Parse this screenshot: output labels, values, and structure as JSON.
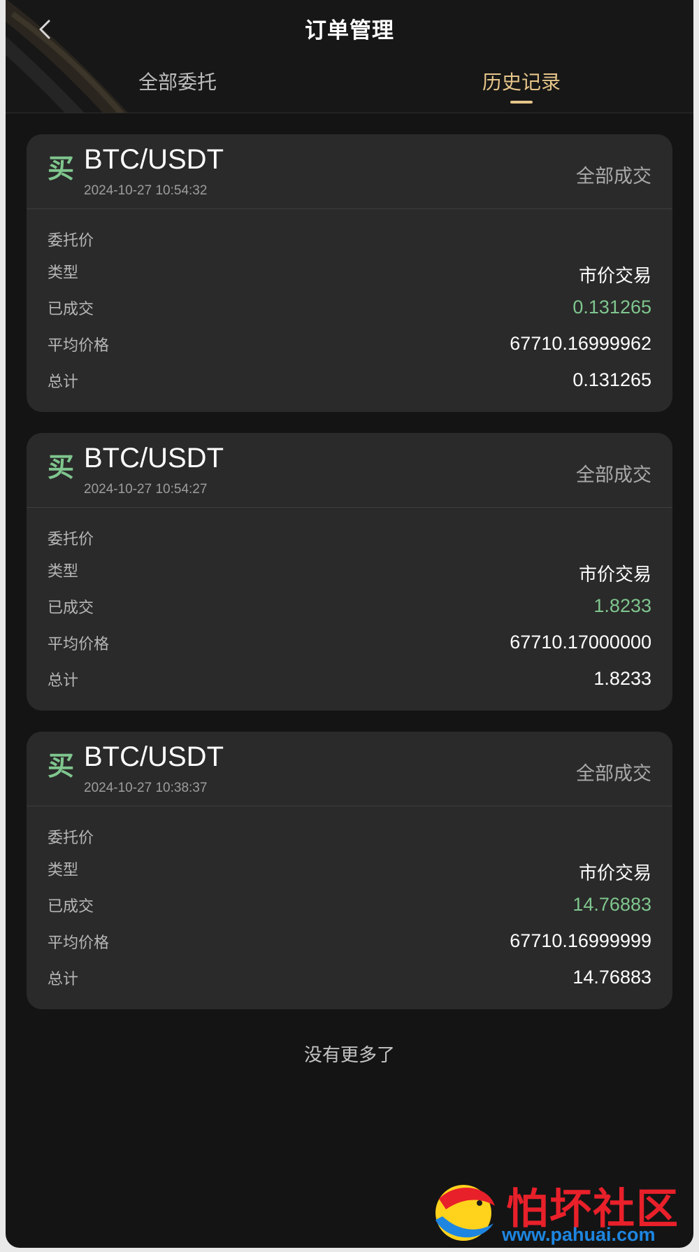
{
  "header": {
    "title": "订单管理",
    "tabs": [
      {
        "label": "全部委托",
        "active": false
      },
      {
        "label": "历史记录",
        "active": true
      }
    ],
    "active_tab_color": "#e6c58a"
  },
  "orders": [
    {
      "side": "买",
      "pair": "BTC/USDT",
      "time": "2024-10-27 10:54:32",
      "status": "全部成交",
      "fields": [
        {
          "label": "委托价",
          "value": ""
        },
        {
          "label": "类型",
          "value": "市价交易"
        },
        {
          "label": "已成交",
          "value": "0.131265"
        },
        {
          "label": "平均价格",
          "value": "67710.16999962"
        },
        {
          "label": "总计",
          "value": "0.131265"
        }
      ]
    },
    {
      "side": "买",
      "pair": "BTC/USDT",
      "time": "2024-10-27 10:54:27",
      "status": "全部成交",
      "fields": [
        {
          "label": "委托价",
          "value": ""
        },
        {
          "label": "类型",
          "value": "市价交易"
        },
        {
          "label": "已成交",
          "value": "1.8233"
        },
        {
          "label": "平均价格",
          "value": "67710.17000000"
        },
        {
          "label": "总计",
          "value": "1.8233"
        }
      ]
    },
    {
      "side": "买",
      "pair": "BTC/USDT",
      "time": "2024-10-27 10:38:37",
      "status": "全部成交",
      "fields": [
        {
          "label": "委托价",
          "value": ""
        },
        {
          "label": "类型",
          "value": "市价交易"
        },
        {
          "label": "已成交",
          "value": "14.76883"
        },
        {
          "label": "平均价格",
          "value": "67710.16999999"
        },
        {
          "label": "总计",
          "value": "14.76883"
        }
      ]
    }
  ],
  "footer": {
    "no_more": "没有更多了"
  },
  "watermark": {
    "name": "怕坏社区",
    "url": "www.pahuai.com"
  },
  "colors": {
    "buy": "#7fc68e",
    "background": "#141414",
    "card": "#2a2a2a"
  }
}
